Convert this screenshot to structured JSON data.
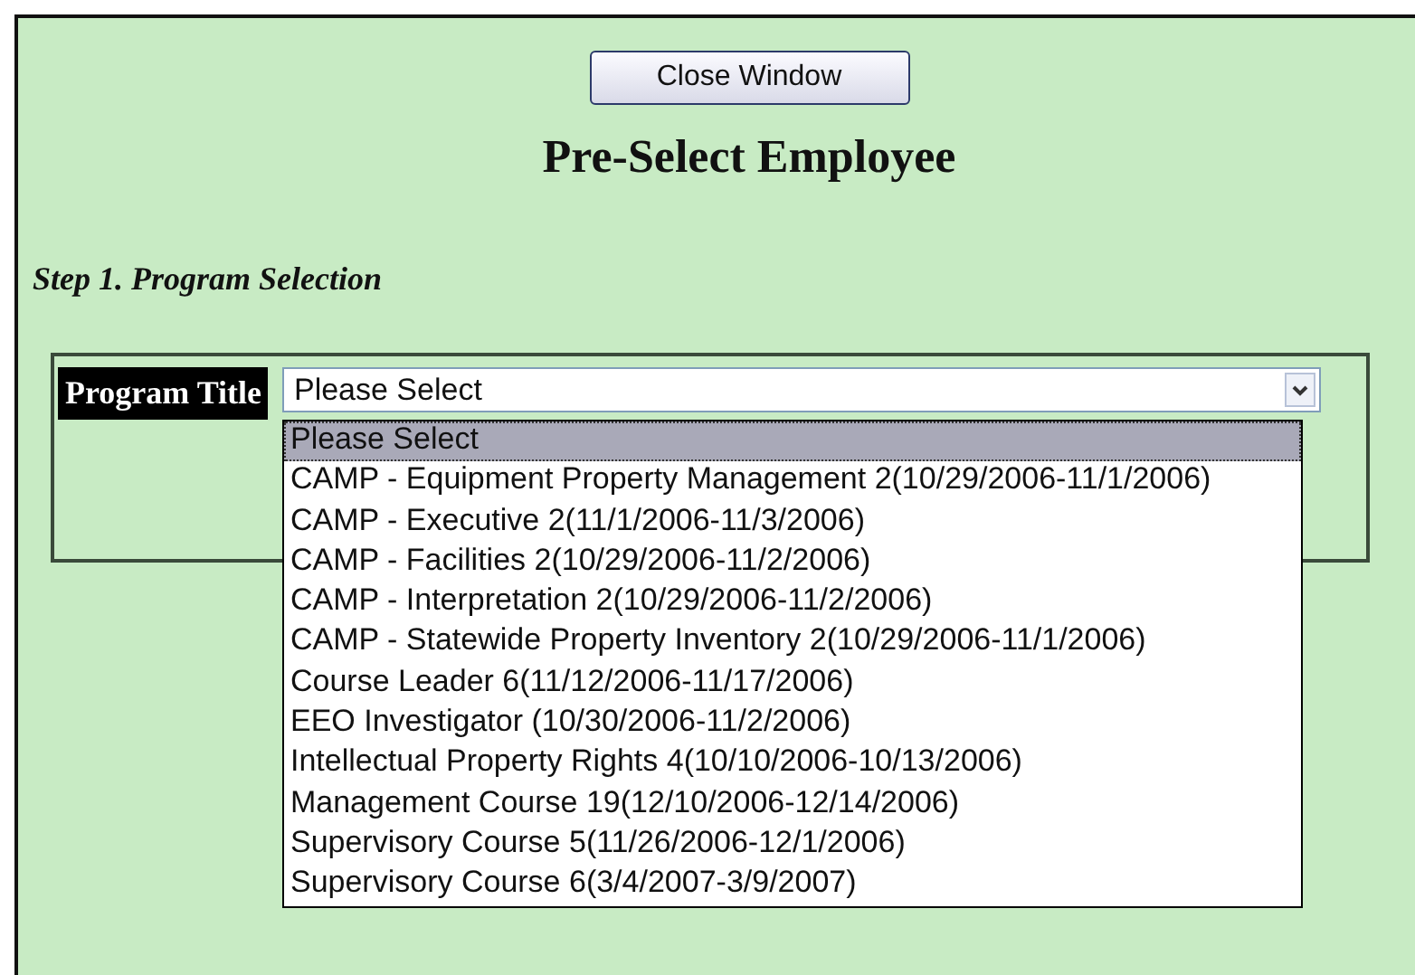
{
  "close_button": "Close Window",
  "heading": "Pre-Select Employee",
  "step_label": "Step 1. Program Selection",
  "program_select": {
    "label": "Program Title",
    "value": "Please Select",
    "options": [
      {
        "label": "Please Select",
        "selected": true
      },
      {
        "label": "CAMP - Equipment Property Management 2(10/29/2006-11/1/2006)",
        "selected": false
      },
      {
        "label": "CAMP - Executive 2(11/1/2006-11/3/2006)",
        "selected": false
      },
      {
        "label": "CAMP - Facilities 2(10/29/2006-11/2/2006)",
        "selected": false
      },
      {
        "label": "CAMP - Interpretation 2(10/29/2006-11/2/2006)",
        "selected": false
      },
      {
        "label": "CAMP - Statewide Property Inventory 2(10/29/2006-11/1/2006)",
        "selected": false
      },
      {
        "label": "Course Leader 6(11/12/2006-11/17/2006)",
        "selected": false
      },
      {
        "label": "EEO Investigator (10/30/2006-11/2/2006)",
        "selected": false
      },
      {
        "label": "Intellectual Property Rights 4(10/10/2006-10/13/2006)",
        "selected": false
      },
      {
        "label": "Management Course 19(12/10/2006-12/14/2006)",
        "selected": false
      },
      {
        "label": "Supervisory Course 5(11/26/2006-12/1/2006)",
        "selected": false
      },
      {
        "label": "Supervisory Course 6(3/4/2007-3/9/2007)",
        "selected": false
      }
    ]
  }
}
